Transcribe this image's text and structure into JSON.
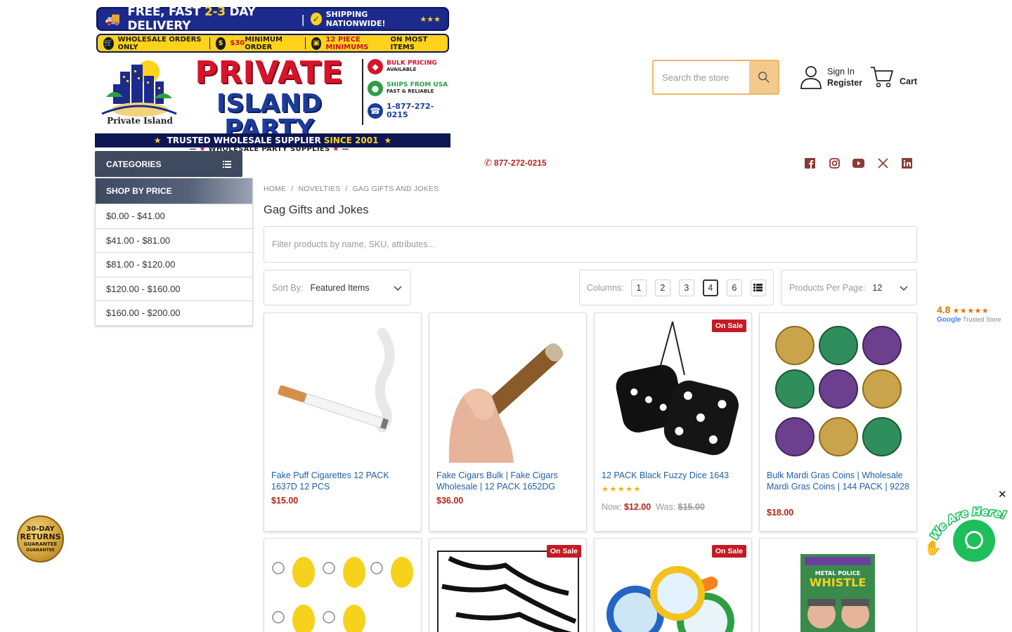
{
  "banner": {
    "promo1_text_a": "FREE, FAST ",
    "promo1_text_b": "2-3",
    "promo1_text_c": " DAY DELIVERY",
    "promo1_text_d": "SHIPPING NATIONWIDE!",
    "promo1_stars": "★★★",
    "promo2_item1": "WHOLESALE ORDERS ONLY",
    "promo2_item2_a": "$30",
    "promo2_item2_b": " MINIMUM ORDER",
    "promo2_item3_a": "12 PIECE MINIMUMS",
    "promo2_item3_b": " ON MOST ITEMS",
    "logo_line1": "PRIVATE",
    "logo_line2": "ISLAND PARTY",
    "logo_line3": "WHOLESALE PARTY SUPPLIES",
    "island_label": "Private Island",
    "feature1_a": "BULK PRICING",
    "feature1_b": "AVAILABLE",
    "feature2_a": "SHIPS FROM USA",
    "feature2_b": "FAST & RELIABLE",
    "feature3_a": "1-877-272-0215",
    "trust_a": "TRUSTED WHOLESALE SUPPLIER",
    "trust_b": "SINCE 2001"
  },
  "header": {
    "search_placeholder": "Search the store",
    "sign_in": "Sign In",
    "register": "Register",
    "cart": "Cart",
    "categories": "CATEGORIES",
    "phone": "877-272-0215",
    "social_icons": [
      "facebook-icon",
      "instagram-icon",
      "youtube-icon",
      "x-icon",
      "linkedin-icon"
    ]
  },
  "sidebar": {
    "heading": "SHOP BY PRICE",
    "items": [
      {
        "label": "$0.00 - $41.00"
      },
      {
        "label": "$41.00 - $81.00"
      },
      {
        "label": "$81.00 - $120.00"
      },
      {
        "label": "$120.00 - $160.00"
      },
      {
        "label": "$160.00 - $200.00"
      }
    ]
  },
  "breadcrumb": [
    "HOME",
    "NOVELTIES",
    "GAG GIFTS AND JOKES"
  ],
  "page_title": "Gag Gifts and Jokes",
  "filter_placeholder": "Filter products by name, SKU, attributes...",
  "toolbar": {
    "sort_label": "Sort By:",
    "sort_value": "Featured Items",
    "columns_label": "Columns:",
    "columns": [
      "1",
      "2",
      "3",
      "4",
      "6"
    ],
    "columns_selected": "4",
    "per_page_label": "Products Per Page:",
    "per_page_value": "12"
  },
  "products": [
    {
      "name": "Fake Puff Cigarettes 12 PACK 1637D 12 PCS",
      "price": "$15.00",
      "on_sale": false
    },
    {
      "name": "Fake Cigars Bulk | Fake Cigars Wholesale | 12 PACK 1652DG",
      "price": "$36.00",
      "on_sale": false
    },
    {
      "name": "12 PACK Black Fuzzy Dice 1643",
      "now_label": "Now:",
      "now": "$12.00",
      "was_label": "Was:",
      "was": "$15.00",
      "stars": "★★★★★",
      "badge": "On Sale",
      "on_sale": true
    },
    {
      "name": "Bulk Mardi Gras Coins | Wholesale Mardi Gras Coins | 144 PACK | 9228",
      "price": "$18.00",
      "on_sale": false
    },
    {
      "name": "",
      "on_sale": false
    },
    {
      "name": "",
      "badge": "On Sale",
      "on_sale": true
    },
    {
      "name": "",
      "badge": "On Sale",
      "on_sale": true
    },
    {
      "name": "",
      "on_sale": false,
      "img_text_a": "METAL POLICE",
      "img_text_b": "WHISTLE"
    }
  ],
  "widgets": {
    "google_rating": "4.8",
    "google_stars": "★★★★★",
    "google_label": "Google",
    "google_trusted": "Trusted Store",
    "returns_a": "30-DAY",
    "returns_b": "RETURNS",
    "returns_c": "GUARANTEE",
    "returns_d": "GUARANTEE",
    "chat_text": "We Are Here!",
    "chat_close": "✕"
  },
  "colors": {
    "navy": "#3e4a60",
    "price_red": "#b42318",
    "link_blue": "#1f5fa8",
    "sale_badge": "#c21b24",
    "search_accent": "#f0b762",
    "chat_green": "#1dbf5b"
  }
}
